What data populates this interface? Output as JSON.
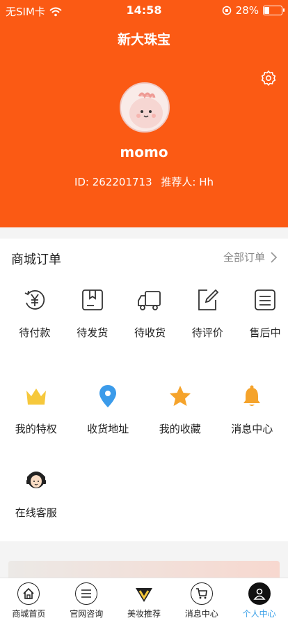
{
  "status_bar": {
    "carrier": "无SIM卡",
    "time": "14:58",
    "battery": "28%",
    "battery_level": 0.28
  },
  "header": {
    "title": "新大珠宝",
    "username": "momo",
    "id_text": "ID: 262201713",
    "referrer_text": "推荐人: Hh",
    "settings_icon": "gear-icon",
    "accent": "#fb5a14"
  },
  "orders": {
    "title": "商城订单",
    "all_label": "全部订单",
    "items": [
      {
        "label": "待付款",
        "icon": "yen-circle-icon"
      },
      {
        "label": "待发货",
        "icon": "package-icon"
      },
      {
        "label": "待收货",
        "icon": "truck-icon"
      },
      {
        "label": "待评价",
        "icon": "edit-icon"
      },
      {
        "label": "售后中",
        "icon": "list-icon"
      }
    ]
  },
  "services": {
    "items": [
      {
        "label": "我的特权",
        "icon": "crown-icon",
        "color": "#f6c83c"
      },
      {
        "label": "收货地址",
        "icon": "location-pin-icon",
        "color": "#3b9bea"
      },
      {
        "label": "我的收藏",
        "icon": "star-icon",
        "color": "#f5a32b"
      },
      {
        "label": "消息中心",
        "icon": "bell-icon",
        "color": "#f5a32b"
      },
      {
        "label": "在线客服",
        "icon": "customer-service-icon",
        "color": "#222222"
      }
    ]
  },
  "tabbar": {
    "items": [
      {
        "label": "商城首页",
        "icon": "home-icon",
        "active": false
      },
      {
        "label": "官网咨询",
        "icon": "menu-icon",
        "active": false
      },
      {
        "label": "美妆推荐",
        "icon": "v-logo-icon",
        "active": false
      },
      {
        "label": "消息中心",
        "icon": "cart-icon",
        "active": false
      },
      {
        "label": "个人中心",
        "icon": "user-icon",
        "active": true
      }
    ],
    "active_color": "#3aa0e8"
  }
}
